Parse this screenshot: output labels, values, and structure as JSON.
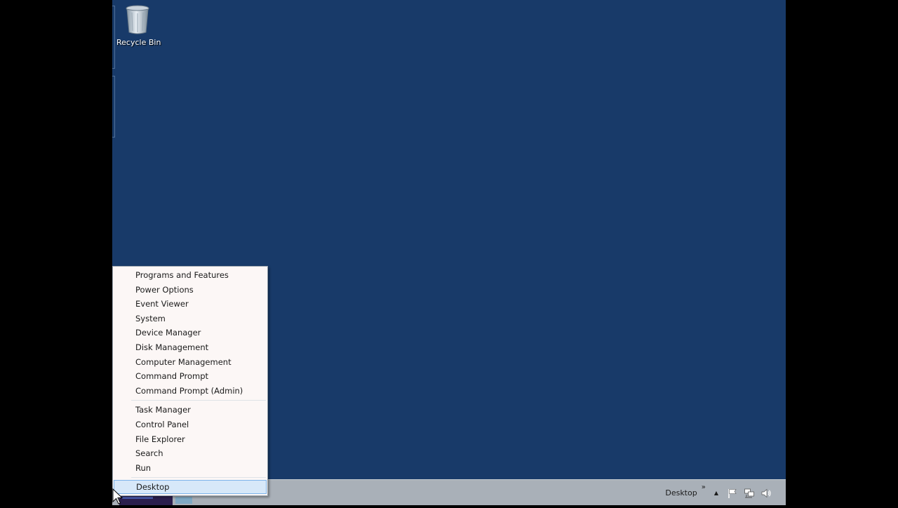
{
  "desktop": {
    "icons": [
      {
        "label": "Recycle Bin",
        "icon": "recycle-bin-icon"
      }
    ]
  },
  "context_menu": {
    "groups": [
      [
        "Programs and Features",
        "Power Options",
        "Event Viewer",
        "System",
        "Device Manager",
        "Disk Management",
        "Computer Management",
        "Command Prompt",
        "Command Prompt (Admin)"
      ],
      [
        "Task Manager",
        "Control Panel",
        "File Explorer",
        "Search",
        "Run"
      ],
      [
        "Desktop"
      ]
    ],
    "selected": "Desktop"
  },
  "taskbar": {
    "toolbar_label": "Desktop",
    "toolbar_chevron": "»",
    "tray_expand": "▲",
    "tray_icons": [
      "flag-icon",
      "network-icon",
      "speaker-icon"
    ]
  },
  "colors": {
    "desktop_background": "#183a69",
    "taskbar": "#a9b0b8",
    "menu_background": "#fcf7f6",
    "selection": "#d7e8f9"
  }
}
